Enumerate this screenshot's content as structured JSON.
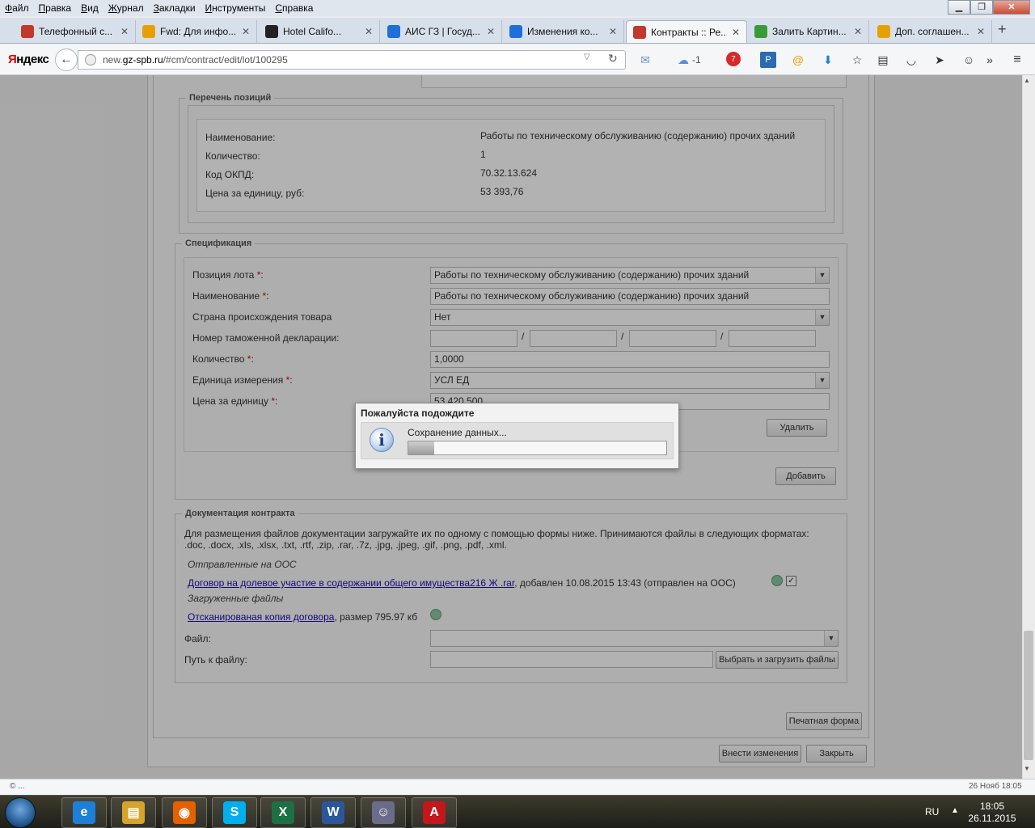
{
  "menu": [
    "Файл",
    "Правка",
    "Вид",
    "Журнал",
    "Закладки",
    "Инструменты",
    "Справка"
  ],
  "window_controls": {
    "minimize": "▁",
    "maximize": "❐",
    "close": "✕"
  },
  "tabs": [
    {
      "label": "Телефонный с...",
      "icon": "gerb-icon",
      "color": "#c0392b"
    },
    {
      "label": "Fwd: Для инфо...",
      "icon": "mail-at-icon",
      "color": "#e6a100"
    },
    {
      "label": "Hotel Califo...",
      "icon": "youtube-play-icon",
      "color": "#222"
    },
    {
      "label": "АИС ГЗ | Госуд...",
      "icon": "globe-icon",
      "color": "#1e6fd9"
    },
    {
      "label": "Изменения ко...",
      "icon": "help-icon",
      "color": "#1e6fd9"
    },
    {
      "label": "Контракты :: Ре...",
      "icon": "tools-icon",
      "color": "#c0392b"
    },
    {
      "label": "Залить Картин...",
      "icon": "image-icon",
      "color": "#3a9a3a"
    },
    {
      "label": "Доп. соглашен...",
      "icon": "mail-at-icon",
      "color": "#e6a100"
    }
  ],
  "active_tab": 5,
  "new_tab": "+",
  "browser": {
    "brand_first": "Я",
    "brand_rest": "ндекс",
    "back": "←",
    "url_prefix": "new.",
    "url_host": "gz-spb.ru",
    "url_path": "/#cm/contract/edit/lot/100295",
    "reload": "↻",
    "weather": "-1",
    "notifications": "7"
  },
  "positions": {
    "legend": "Перечень позиций",
    "rows": [
      {
        "label": "Наименование:",
        "value": "Работы по техническому обслуживанию (содержанию) прочих зданий"
      },
      {
        "label": "Количество:",
        "value": "1"
      },
      {
        "label": "Код ОКПД:",
        "value": "70.32.13.624"
      },
      {
        "label": "Цена за единицу, руб:",
        "value": "53 393,76"
      }
    ]
  },
  "spec": {
    "legend": "Спецификация",
    "lot_position": {
      "label": "Позиция лота ",
      "value": "Работы по техническому обслуживанию (содержанию) прочих зданий"
    },
    "name": {
      "label": "Наименование ",
      "value": "Работы по техническому обслуживанию (содержанию) прочих зданий"
    },
    "country": {
      "label": "Страна происхождения товара",
      "value": "Нет"
    },
    "customs": {
      "label": "Номер таможенной декларации:",
      "sep": "/"
    },
    "quantity": {
      "label": "Количество ",
      "value": "1,0000"
    },
    "unit": {
      "label": "Единица измерения ",
      "value": "УСЛ ЕД"
    },
    "price": {
      "label": "Цена за единицу ",
      "value": "53 420,500"
    },
    "required_mark": "*",
    "colon": ":",
    "delete_button": "Удалить",
    "add_button": "Добавить"
  },
  "docs": {
    "legend": "Документация контракта",
    "info": "Для размещения файлов документации загружайте их по одному с помощью формы ниже. Принимаются файлы в следующих форматах:",
    "formats": ".doc, .docx, .xls, .xlsx, .txt, .rtf, .zip, .rar, .7z, .jpg, .jpeg, .gif, .png, .pdf, .xml.",
    "sent_heading": "Отправленные на ООС",
    "sent_file_link": "Договор на долевое участие в содержании общего имущества216  Ж  .rar",
    "sent_file_meta": ", добавлен 10.08.2015 13:43 (отправлен на ООС)",
    "uploaded_heading": "Загруженные файлы",
    "uploaded_file_link": "Отсканированая копия договора",
    "uploaded_file_meta": ", размер 795.97 кб",
    "file_label": "Файл:",
    "path_label": "Путь к файлу:",
    "upload_button": "Выбрать и загрузить файлы"
  },
  "print_button": "Печатная форма",
  "apply_button": "Внести изменения",
  "close_button": "Закрыть",
  "dialog": {
    "title": "Пожалуйста подождите",
    "message": "Сохранение данных...",
    "progress": 0.1
  },
  "status": {
    "left": "© ...",
    "right": "26 Нояб 18:05"
  },
  "taskbar": {
    "apps": [
      {
        "name": "internet-explorer",
        "glyph": "e",
        "color": "#1e7fd6"
      },
      {
        "name": "file-explorer",
        "glyph": "▤",
        "color": "#d6a32b"
      },
      {
        "name": "firefox",
        "glyph": "◉",
        "color": "#e66000"
      },
      {
        "name": "skype",
        "glyph": "S",
        "color": "#00aff0"
      },
      {
        "name": "excel",
        "glyph": "X",
        "color": "#1d7044"
      },
      {
        "name": "word",
        "glyph": "W",
        "color": "#2b579a"
      },
      {
        "name": "user-app",
        "glyph": "☺",
        "color": "#6b6b8a"
      },
      {
        "name": "acrobat",
        "glyph": "A",
        "color": "#c4161c"
      }
    ],
    "lang": "RU",
    "tray_up": "▲",
    "time": "18:05",
    "date": "26.11.2015"
  }
}
